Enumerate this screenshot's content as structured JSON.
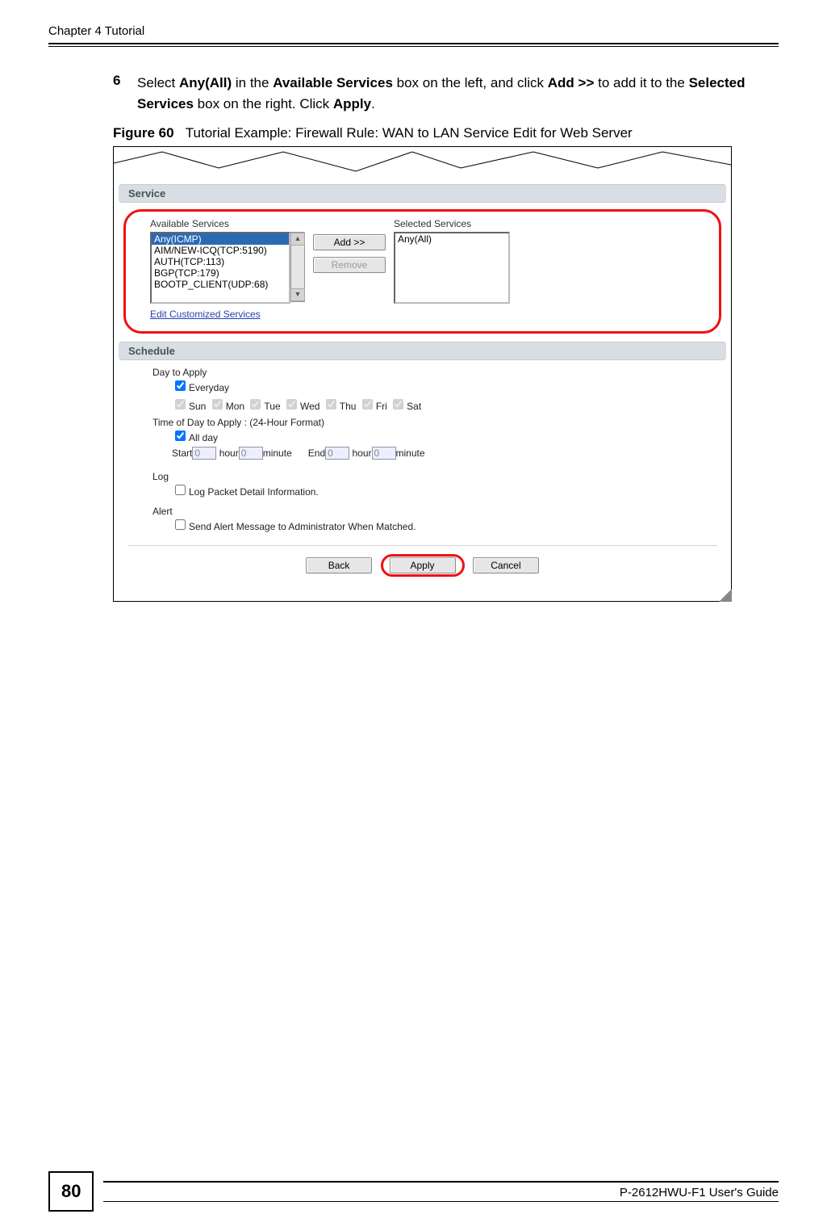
{
  "header": {
    "chapter": "Chapter 4 Tutorial"
  },
  "step": {
    "number": "6",
    "pre": "Select ",
    "bold1": "Any(All)",
    "mid1": " in the ",
    "bold2": "Available Services",
    "mid2": " box on the left, and click ",
    "bold3": "Add >>",
    "mid3": " to add it to the ",
    "bold4": "Selected Services",
    "mid4": " box on the right. Click ",
    "bold5": "Apply",
    "end": "."
  },
  "figure": {
    "label": "Figure 60",
    "caption": "Tutorial Example: Firewall Rule: WAN to LAN Service Edit for Web Server"
  },
  "sections": {
    "service": "Service",
    "schedule": "Schedule"
  },
  "service": {
    "available_label": "Available Services",
    "selected_label": "Selected Services",
    "available_items": [
      "Any(ICMP)",
      "AIM/NEW-ICQ(TCP:5190)",
      "AUTH(TCP:113)",
      "BGP(TCP:179)",
      "BOOTP_CLIENT(UDP:68)"
    ],
    "selected_items": [
      "Any(All)"
    ],
    "add_label": "Add >>",
    "remove_label": "Remove",
    "edit_link": "Edit Customized Services"
  },
  "schedule": {
    "day_label": "Day to Apply",
    "everyday": "Everyday",
    "days": [
      "Sun",
      "Mon",
      "Tue",
      "Wed",
      "Thu",
      "Fri",
      "Sat"
    ],
    "time_label": "Time of Day to Apply : (24-Hour Format)",
    "all_day": "All day",
    "start": "Start",
    "hour": "hour",
    "minute": "minute",
    "end": "End",
    "start_h": "0",
    "start_m": "0",
    "end_h": "0",
    "end_m": "0",
    "log_label": "Log",
    "log_opt": "Log Packet Detail Information.",
    "alert_label": "Alert",
    "alert_opt": "Send Alert Message to Administrator When Matched."
  },
  "buttons": {
    "back": "Back",
    "apply": "Apply",
    "cancel": "Cancel"
  },
  "footer": {
    "page": "80",
    "guide": "P-2612HWU-F1 User's Guide"
  }
}
